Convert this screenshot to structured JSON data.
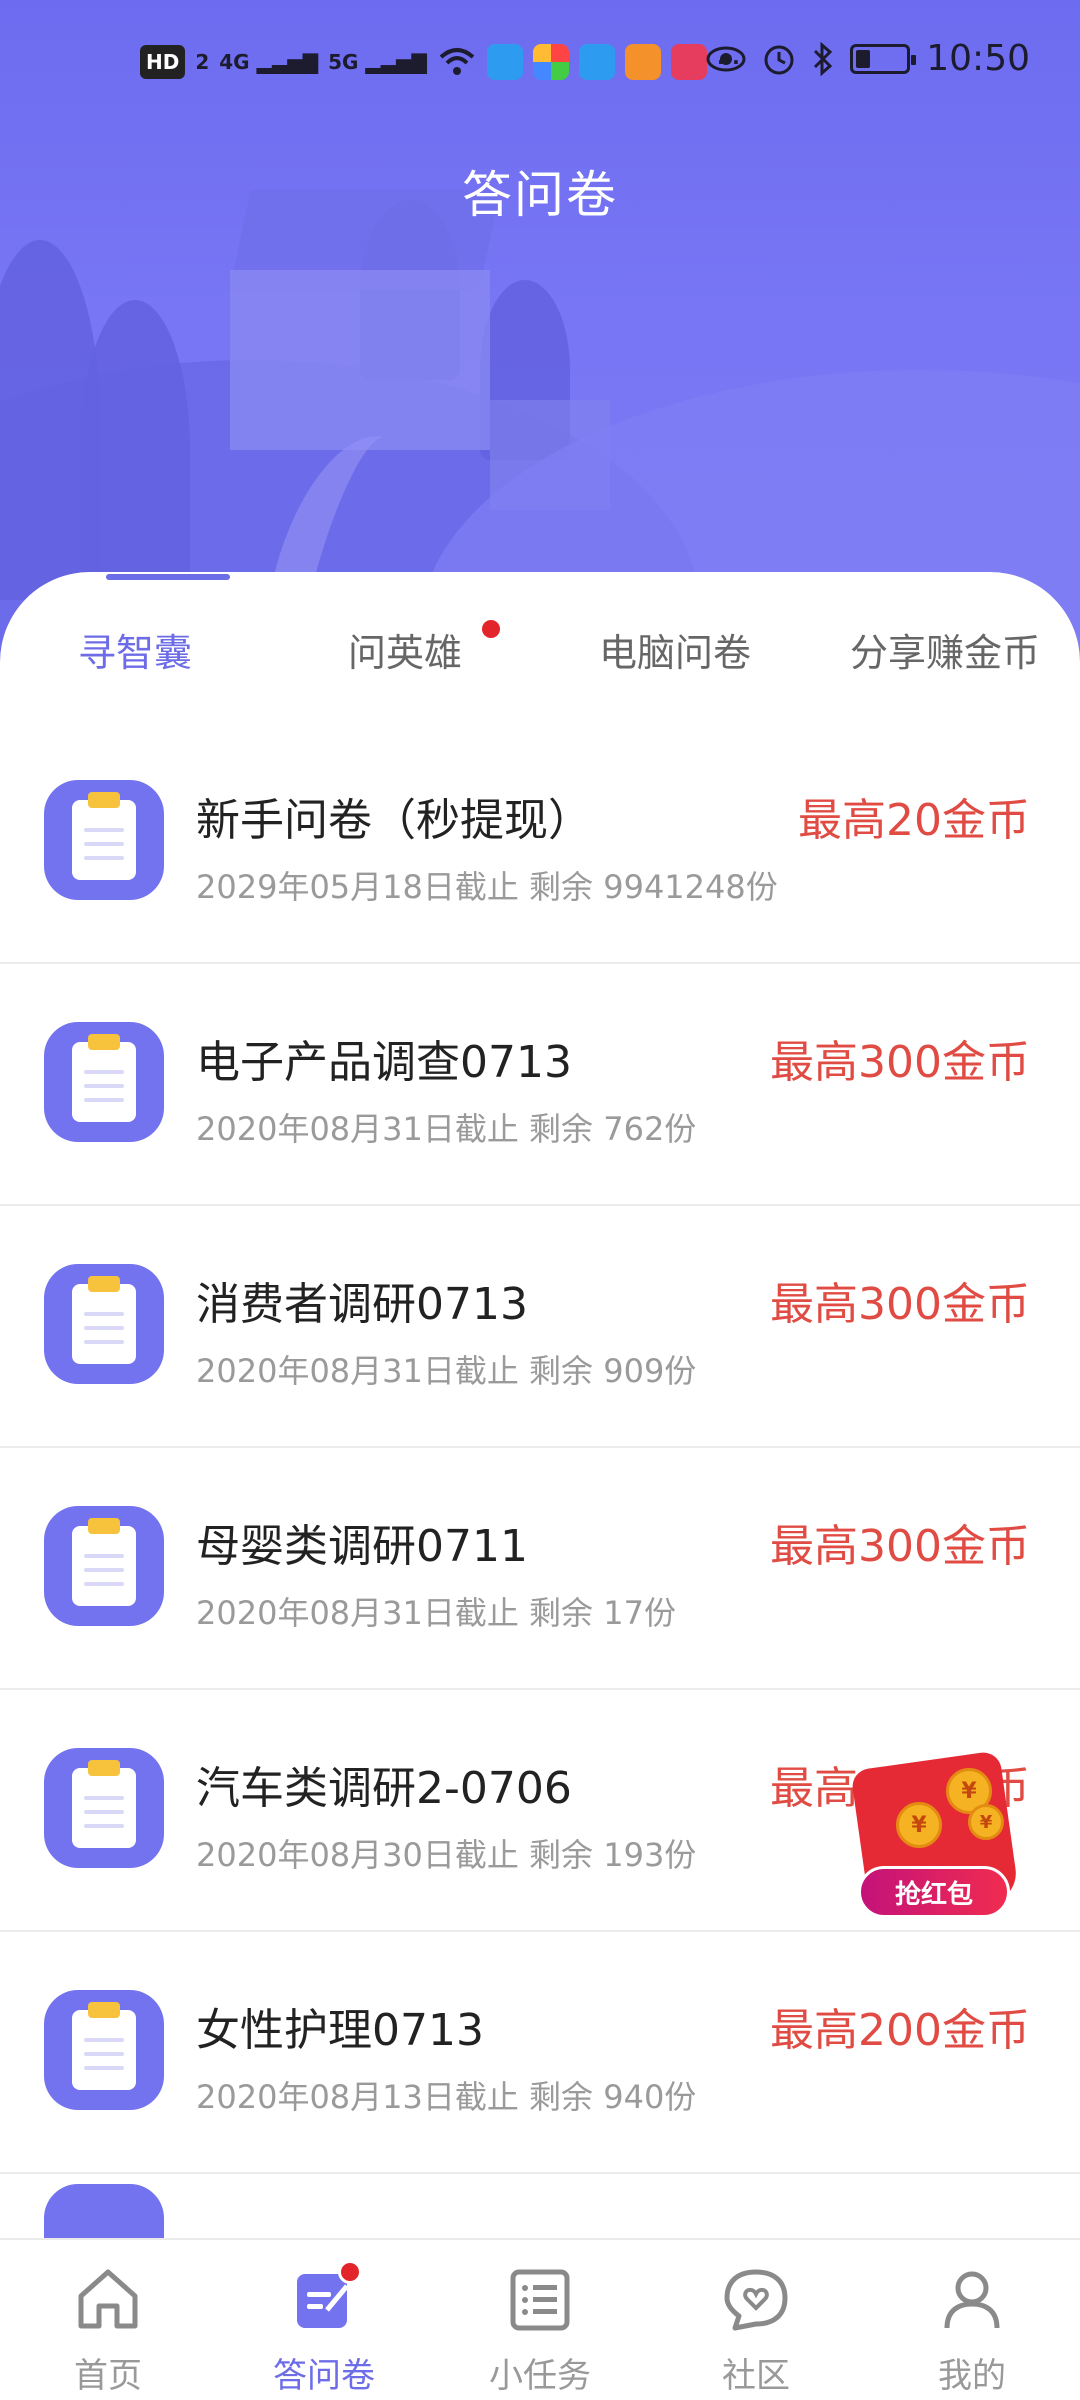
{
  "status_bar": {
    "left_chips": [
      "HD",
      "2",
      "4G",
      "5G"
    ],
    "apps_more": "···",
    "time": "10:50"
  },
  "header": {
    "title": "答问卷"
  },
  "tabs": [
    {
      "label": "寻智囊",
      "active": true,
      "badge": false
    },
    {
      "label": "问英雄",
      "active": false,
      "badge": true
    },
    {
      "label": "电脑问卷",
      "active": false,
      "badge": false
    },
    {
      "label": "分享赚金币",
      "active": false,
      "badge": false
    }
  ],
  "surveys": [
    {
      "title": "新手问卷（秒提现）",
      "meta": "2029年05月18日截止 剩余 9941248份",
      "reward": "最高20金币"
    },
    {
      "title": "电子产品调查0713",
      "meta": "2020年08月31日截止 剩余 762份",
      "reward": "最高300金币"
    },
    {
      "title": "消费者调研0713",
      "meta": "2020年08月31日截止 剩余 909份",
      "reward": "最高300金币"
    },
    {
      "title": "母婴类调研0711",
      "meta": "2020年08月31日截止 剩余 17份",
      "reward": "最高300金币"
    },
    {
      "title": "汽车类调研2-0706",
      "meta": "2020年08月30日截止 剩余 193份",
      "reward": "最高200金币"
    },
    {
      "title": "女性护理0713",
      "meta": "2020年08月13日截止 剩余 940份",
      "reward": "最高200金币"
    }
  ],
  "red_packet": {
    "label": "抢红包",
    "coin_symbol": "¥"
  },
  "bottom_nav": [
    {
      "label": "首页",
      "icon": "home-icon",
      "active": false
    },
    {
      "label": "答问卷",
      "icon": "survey-icon",
      "active": true,
      "badge": true
    },
    {
      "label": "小任务",
      "icon": "task-list-icon",
      "active": false
    },
    {
      "label": "社区",
      "icon": "community-heart-icon",
      "active": false
    },
    {
      "label": "我的",
      "icon": "profile-icon",
      "active": false
    }
  ],
  "colors": {
    "brand": "#6e6de8",
    "header_bg": "#7876f4",
    "reward": "#e04b43",
    "badge": "#e4242b"
  }
}
